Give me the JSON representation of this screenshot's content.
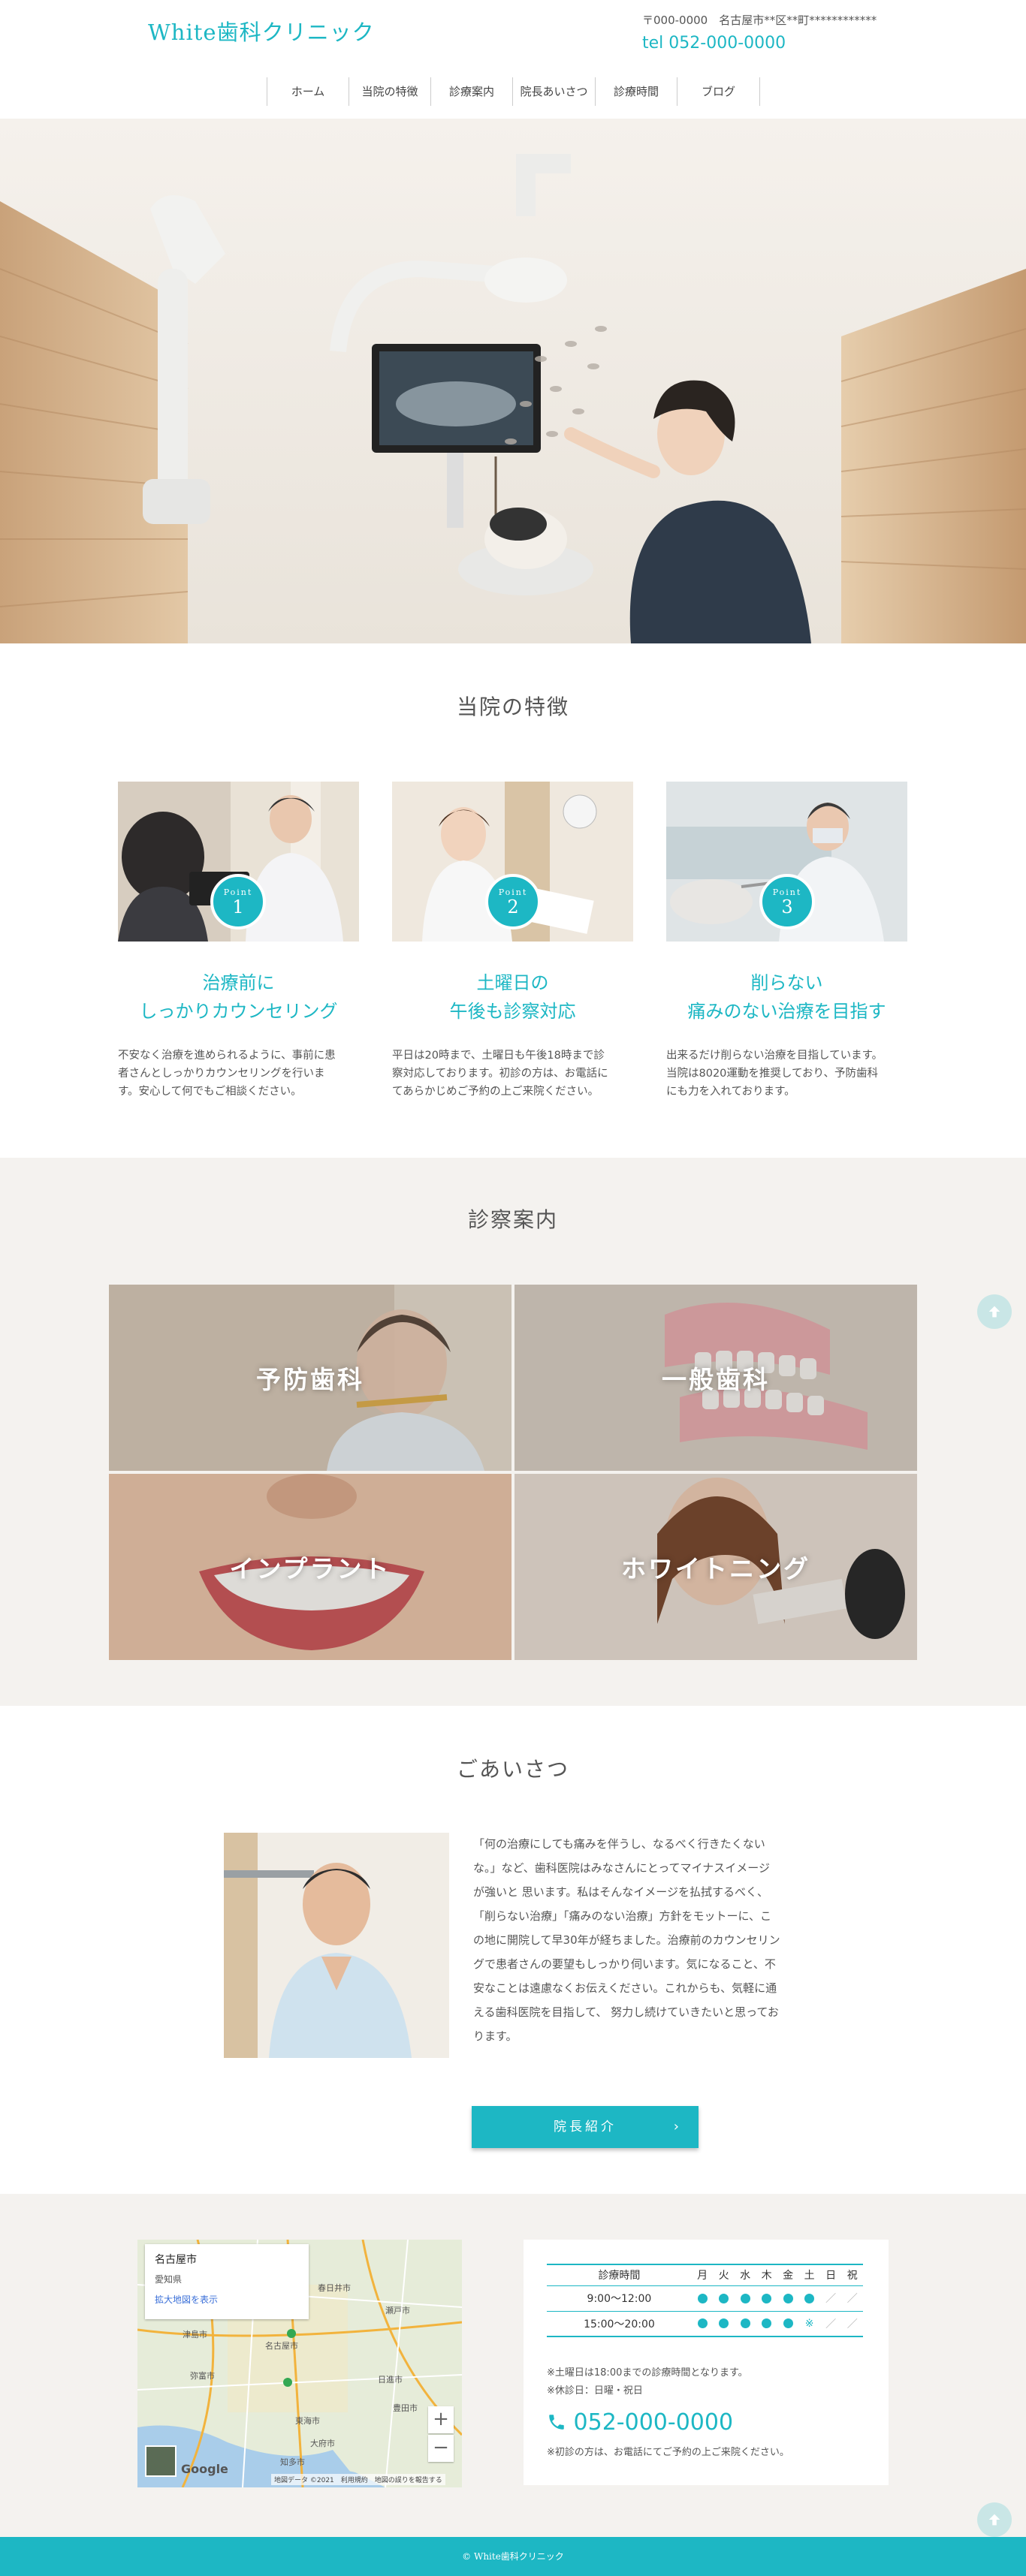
{
  "header": {
    "logo": "White歯科クリニック",
    "address": "〒000-0000　名古屋市**区**町************",
    "tel": "tel 052-000-0000"
  },
  "nav": [
    "ホーム",
    "当院の特徴",
    "診療案内",
    "院長あいさつ",
    "診療時間",
    "ブログ"
  ],
  "features": {
    "title": "当院の特徴",
    "items": [
      {
        "point_label": "Point",
        "number": "1",
        "title_line1": "治療前に",
        "title_line2": "しっかりカウンセリング",
        "text": [
          "不安なく治療を進められるように、事前に患",
          "者さんとしっかりカウンセリングを行いま",
          "す。安心して何でもご相談ください。"
        ]
      },
      {
        "point_label": "Point",
        "number": "2",
        "title_line1": "土曜日の",
        "title_line2": "午後も診察対応",
        "text": [
          "平日は20時まで、土曜日も午後18時まで診",
          "察対応しております。初診の方は、お電話に",
          "てあらかじめご予約の上ご来院ください。"
        ]
      },
      {
        "point_label": "Point",
        "number": "3",
        "title_line1": "削らない",
        "title_line2": "痛みのない治療を目指す",
        "text": [
          "出来るだけ削らない治療を目指しています。",
          "当院は8020運動を推奨しており、予防歯科",
          "にも力を入れております。"
        ]
      }
    ]
  },
  "services": {
    "title": "診察案内",
    "items": [
      "予防歯科",
      "一般歯科",
      "インプラント",
      "ホワイトニング"
    ]
  },
  "greeting": {
    "title": "ごあいさつ",
    "text": [
      "「何の治療にしても痛みを伴うし、なるべく行きたくない",
      "な。」など、歯科医院はみなさんにとってマイナスイメージ",
      "が強いと 思います。私はそんなイメージを払拭するべく、",
      "「削らない治療」「痛みのない治療」方針をモットーに、こ",
      "の地に開院して早30年が経ちました。治療前のカウンセリン",
      "グで患者さんの要望もしっかり伺います。気になること、不",
      "安なことは遠慮なくお伝えください。これからも、気軽に通",
      "える歯科医院を目指して、 努力し続けていきたいと思ってお",
      "ります。"
    ],
    "button": "院長紹介",
    "button_arrow": "›"
  },
  "map": {
    "place": "名古屋市",
    "region": "愛知県",
    "link": "拡大地図を表示",
    "zoom_in": "+",
    "zoom_out": "−",
    "logo": "Google",
    "credit": "地図データ ©2021　利用規約　地図の誤りを報告する"
  },
  "hours": {
    "header": [
      "診療時間",
      "月",
      "火",
      "水",
      "木",
      "金",
      "土",
      "日",
      "祝"
    ],
    "rows": [
      {
        "time": "9:00〜12:00",
        "marks": [
          "dot",
          "dot",
          "dot",
          "dot",
          "dot",
          "dot",
          "slash",
          "slash"
        ]
      },
      {
        "time": "15:00〜20:00",
        "marks": [
          "dot",
          "dot",
          "dot",
          "dot",
          "dot",
          "ast",
          "slash",
          "slash"
        ]
      }
    ],
    "note1": "※土曜日は18:00までの診療時間となります。",
    "note2": "※休診日：日曜・祝日",
    "phone": "052-000-0000",
    "note3": "※初診の方は、お電話にてご予約の上ご来院ください。"
  },
  "footer": "© White歯科クリニック",
  "colors": {
    "accent": "#1db7c4",
    "section_bg": "#f4f2ef"
  },
  "icons": {
    "phone": "phone-icon",
    "to_top": "arrow-up-icon",
    "dot": "●",
    "slash": "／",
    "ast": "※"
  }
}
